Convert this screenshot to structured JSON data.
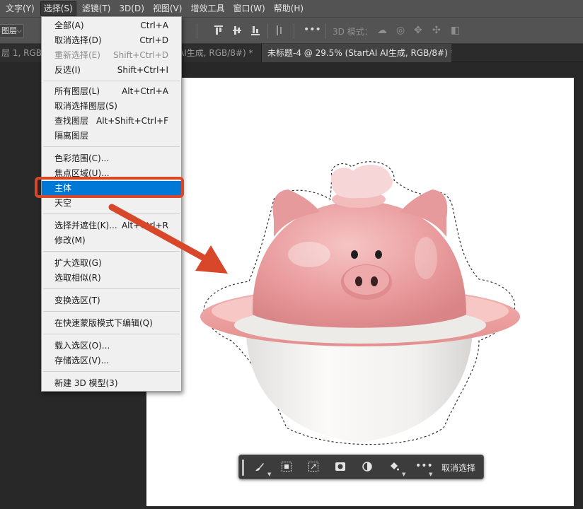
{
  "menubar": {
    "items": [
      "文字(Y)",
      "选择(S)",
      "滤镜(T)",
      "3D(D)",
      "视图(V)",
      "增效工具",
      "窗口(W)",
      "帮助(H)"
    ]
  },
  "options": {
    "layer_select": "图层",
    "mode_label": "3D 模式："
  },
  "tabs": {
    "inactive_left": "层 1, RGB/8#",
    "inactive_mid": "AI生成, RGB/8#) *",
    "active": "未标题-4 @ 29.5% (StartAI AI生成, RGB/8#) *"
  },
  "dropdown": {
    "items": [
      {
        "label": "全部(A)",
        "shortcut": "Ctrl+A"
      },
      {
        "label": "取消选择(D)",
        "shortcut": "Ctrl+D"
      },
      {
        "label": "重新选择(E)",
        "shortcut": "Shift+Ctrl+D"
      },
      {
        "label": "反选(I)",
        "shortcut": "Shift+Ctrl+I"
      },
      {
        "label": "所有图层(L)",
        "shortcut": "Alt+Ctrl+A"
      },
      {
        "label": "取消选择图层(S)",
        "shortcut": ""
      },
      {
        "label": "查找图层",
        "shortcut": "Alt+Shift+Ctrl+F"
      },
      {
        "label": "隔离图层",
        "shortcut": ""
      },
      {
        "label": "色彩范围(C)...",
        "shortcut": ""
      },
      {
        "label": "焦点区域(U)...",
        "shortcut": ""
      },
      {
        "label": "主体",
        "shortcut": ""
      },
      {
        "label": "天空",
        "shortcut": ""
      },
      {
        "label": "选择并遮住(K)...",
        "shortcut": "Alt+Ctrl+R"
      },
      {
        "label": "修改(M)",
        "shortcut": ""
      },
      {
        "label": "扩大选取(G)",
        "shortcut": ""
      },
      {
        "label": "选取相似(R)",
        "shortcut": ""
      },
      {
        "label": "变换选区(T)",
        "shortcut": ""
      },
      {
        "label": "在快速蒙版模式下编辑(Q)",
        "shortcut": ""
      },
      {
        "label": "载入选区(O)...",
        "shortcut": ""
      },
      {
        "label": "存储选区(V)...",
        "shortcut": ""
      },
      {
        "label": "新建 3D 模型(3)",
        "shortcut": ""
      }
    ]
  },
  "taskbar": {
    "deselect_label": "取消选择"
  },
  "colors": {
    "annotation": "#d9472b",
    "menu_highlight": "#0078d7",
    "pig_pink": "#eaa3a5",
    "bowl_white": "#f4f3f1"
  },
  "icons": {
    "brush": "brush-icon",
    "mask": "mask-icon",
    "transform": "transform-icon",
    "circle_mask": "circle-mask-icon",
    "adjust": "half-circle-icon",
    "fill": "paint-bucket-icon",
    "more": "more-dots-icon"
  }
}
